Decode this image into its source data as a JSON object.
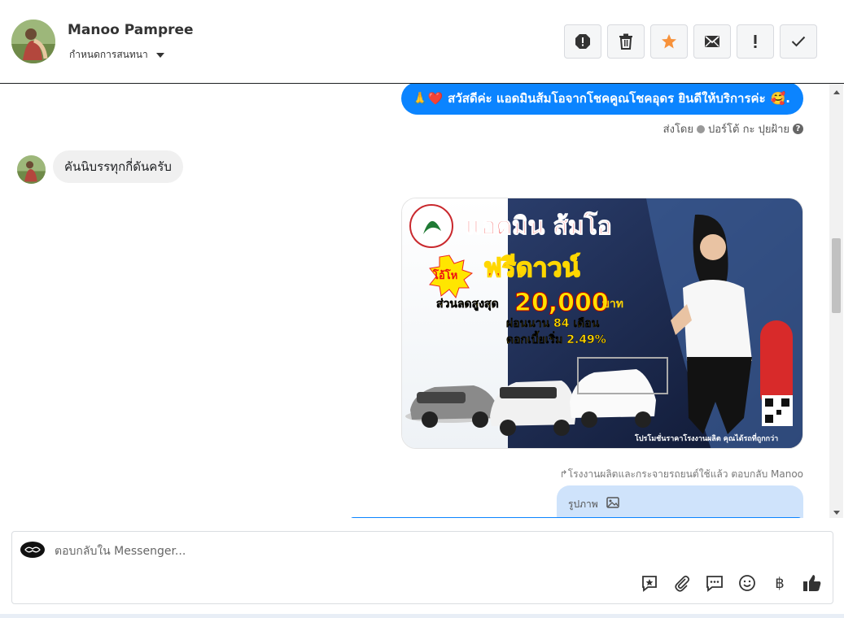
{
  "header": {
    "contact_name": "Manoo Pampree",
    "conversation_settings": "กำหนดการสนทนา",
    "toolbar": [
      {
        "name": "report-icon"
      },
      {
        "name": "trash-icon"
      },
      {
        "name": "star-icon",
        "color": "#f7923b"
      },
      {
        "name": "mail-icon"
      },
      {
        "name": "important-icon"
      },
      {
        "name": "check-icon"
      }
    ]
  },
  "thread": {
    "outgoing_greeting": "สวัสดีค่ะ แอดมินส้มโอจากโชคคูณโชคอุดร ยินดีให้บริการค่ะ",
    "greeting_prefix_emoji": "🙏❤️",
    "greeting_suffix_emoji": "🥰.",
    "sent_by_label": "ส่งโดย",
    "sent_by_name": "ปอร์โต้ กะ ปุยฝ้าย",
    "incoming_message": "คันนิบรรทุกกี่ดันครับ",
    "promo": {
      "headline": "แอดมิน ส้มโอ",
      "badge": "โอ้โห",
      "offer": "ฟรีดาวน์",
      "discount_label": "ส่วนลดสูงสุด",
      "discount_amount": "20,000",
      "discount_unit": "บาท",
      "installment": "ผ่อนนาน 84 เดือน",
      "interest": "ดอกเบี้ยเริ่ม 2.49%",
      "footer": "โปรโมชั่นราคาโรงงานผลิต คุณได้รถที่ถูกกว่า"
    },
    "reply_meta": "โรงงานผลิตและกระจายรถยนต์ใช้แล้ว ตอบกลับ Manoo",
    "reply_preview": "รูปภาพ"
  },
  "composer": {
    "placeholder": "ตอบกลับใน Messenger...",
    "tools": [
      "saved-reply-icon",
      "attachment-icon",
      "message-template-icon",
      "emoji-icon",
      "baht-icon",
      "thumbs-up-icon"
    ],
    "baht_symbol": "฿"
  },
  "colors": {
    "accent": "#0b84ff",
    "reply_bg": "#cfe3fb"
  }
}
